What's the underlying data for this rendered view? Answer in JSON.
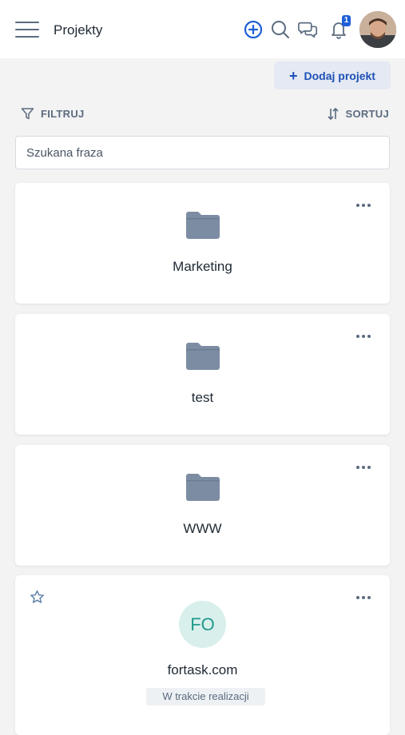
{
  "header": {
    "title": "Projekty",
    "notification_count": "1",
    "icons": [
      "menu-icon",
      "add-circle-icon",
      "search-icon",
      "chat-icon",
      "bell-icon",
      "avatar"
    ]
  },
  "toolbar": {
    "add_project_label": "Dodaj projekt",
    "filter_label": "FILTRUJ",
    "sort_label": "SORTUJ"
  },
  "search": {
    "placeholder": "Szukana fraza",
    "value": ""
  },
  "projects": [
    {
      "name": "Marketing",
      "type": "folder"
    },
    {
      "name": "test",
      "type": "folder"
    },
    {
      "name": "WWW",
      "type": "folder"
    },
    {
      "name": "fortask.com",
      "type": "project",
      "initials": "FO",
      "status": "W trakcie realizacji"
    }
  ],
  "colors": {
    "accent": "#1e5fd6",
    "folder": "#7c8ca3",
    "initials_bg": "#d9efec",
    "initials_text": "#1f9a8a"
  }
}
